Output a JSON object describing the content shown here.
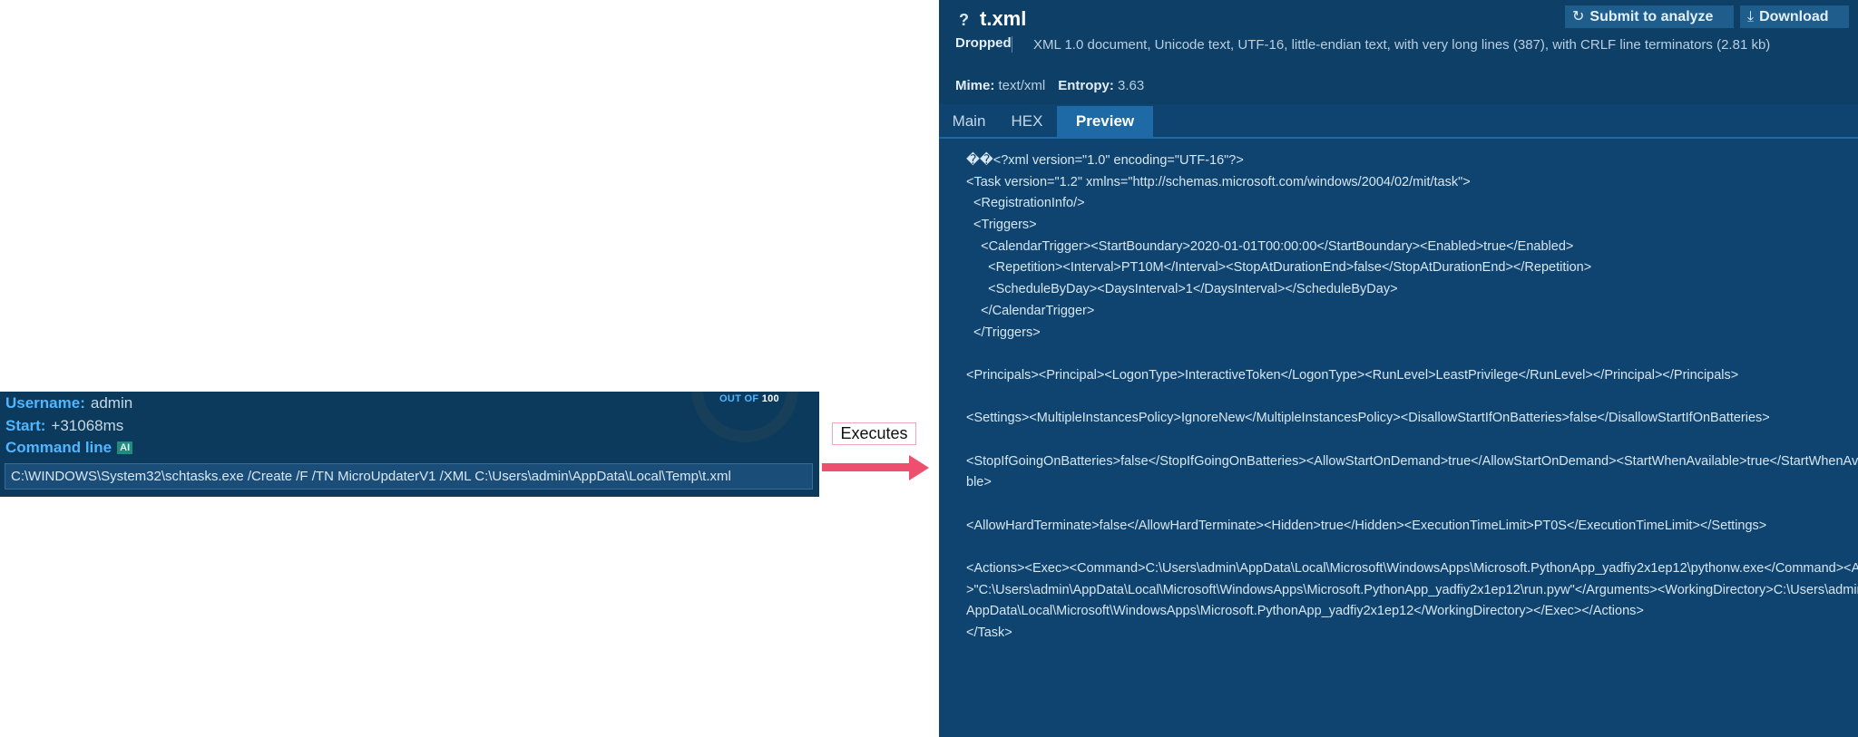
{
  "process": {
    "username_label": "Username:",
    "username_value": "admin",
    "start_label": "Start:",
    "start_value": "+31068ms",
    "cmdline_label": "Command line",
    "ai_badge": "AI",
    "command": "C:\\WINDOWS\\System32\\schtasks.exe /Create /F /TN MicroUpdaterV1 /XML C:\\Users\\admin\\AppData\\Local\\Temp\\t.xml",
    "score": {
      "out_of_label": "OUT OF",
      "max": "100"
    }
  },
  "connector": {
    "label": "Executes",
    "arrow_color": "#ef4f6e"
  },
  "file": {
    "icon": "question-icon",
    "name": "t.xml",
    "submit_button": {
      "label": "Submit to analyze",
      "icon": "refresh-icon"
    },
    "download_button": {
      "label": "Download",
      "icon": "download-icon"
    },
    "dropped_label": "Dropped",
    "description": "XML 1.0 document, Unicode text, UTF-16, little-endian text, with very long lines (387), with CRLF line terminators (2.81 kb)",
    "mime_label": "Mime:",
    "mime_value": "text/xml",
    "entropy_label": "Entropy:",
    "entropy_value": "3.63",
    "tabs": [
      {
        "label": "Main"
      },
      {
        "label": "HEX"
      },
      {
        "label": "Preview",
        "active": true
      }
    ],
    "preview_lines": [
      "��<?xml version=\"1.0\" encoding=\"UTF-16\"?>",
      "<Task version=\"1.2\" xmlns=\"http://schemas.microsoft.com/windows/2004/02/mit/task\">",
      "  <RegistrationInfo/>",
      "  <Triggers>",
      "    <CalendarTrigger><StartBoundary>2020-01-01T00:00:00</StartBoundary><Enabled>true</Enabled>",
      "      <Repetition><Interval>PT10M</Interval><StopAtDurationEnd>false</StopAtDurationEnd></Repetition>",
      "      <ScheduleByDay><DaysInterval>1</DaysInterval></ScheduleByDay>",
      "    </CalendarTrigger>",
      "  </Triggers>",
      "",
      "<Principals><Principal><LogonType>InteractiveToken</LogonType><RunLevel>LeastPrivilege</RunLevel></Principal></Principals>",
      "",
      "<Settings><MultipleInstancesPolicy>IgnoreNew</MultipleInstancesPolicy><DisallowStartIfOnBatteries>false</DisallowStartIfOnBatteries>",
      "",
      "<StopIfGoingOnBatteries>false</StopIfGoingOnBatteries><AllowStartOnDemand>true</AllowStartOnDemand><StartWhenAvailable>true</StartWhenAvailable>",
      "",
      "<AllowHardTerminate>false</AllowHardTerminate><Hidden>true</Hidden><ExecutionTimeLimit>PT0S</ExecutionTimeLimit></Settings>",
      "",
      "<Actions><Exec><Command>C:\\Users\\admin\\AppData\\Local\\Microsoft\\WindowsApps\\Microsoft.PythonApp_yadfiy2x1ep12\\pythonw.exe</Command><Arguments>\"C:\\Users\\admin\\AppData\\Local\\Microsoft\\WindowsApps\\Microsoft.PythonApp_yadfiy2x1ep12\\run.pyw\"</Arguments><WorkingDirectory>C:\\Users\\admin\\AppData\\Local\\Microsoft\\WindowsApps\\Microsoft.PythonApp_yadfiy2x1ep12</WorkingDirectory></Exec></Actions>",
      "</Task>"
    ]
  }
}
